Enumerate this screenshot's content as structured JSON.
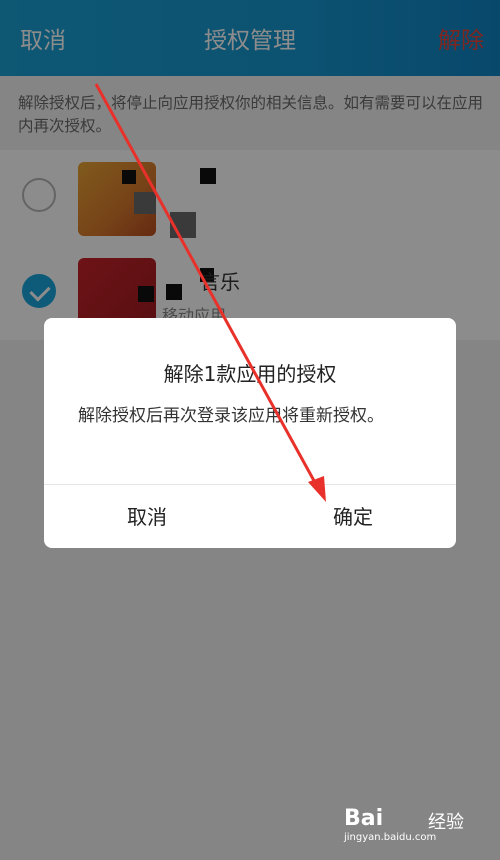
{
  "header": {
    "cancel_label": "取消",
    "title": "授权管理",
    "remove_label": "解除"
  },
  "notice_text": "解除授权后，将停止向应用授权你的相关信息。如有需要可以在应用内再次授权。",
  "app_list": {
    "items": [
      {
        "checked": false,
        "name": "",
        "subtitle": ""
      },
      {
        "checked": true,
        "name": "言乐",
        "subtitle": "移动应用"
      }
    ]
  },
  "dialog": {
    "title": "解除1款应用的授权",
    "message": "解除授权后再次登录该应用将重新授权。",
    "cancel_label": "取消",
    "confirm_label": "确定"
  },
  "watermark": {
    "brand": "Bai",
    "brand_suffix": "经验",
    "url": "jingyan.baidu.com"
  },
  "colors": {
    "header_bg": "#1aa0d4",
    "remove_text": "#e6473d",
    "checked_radio": "#1aa7dc",
    "annotation_arrow": "#e8312a"
  }
}
